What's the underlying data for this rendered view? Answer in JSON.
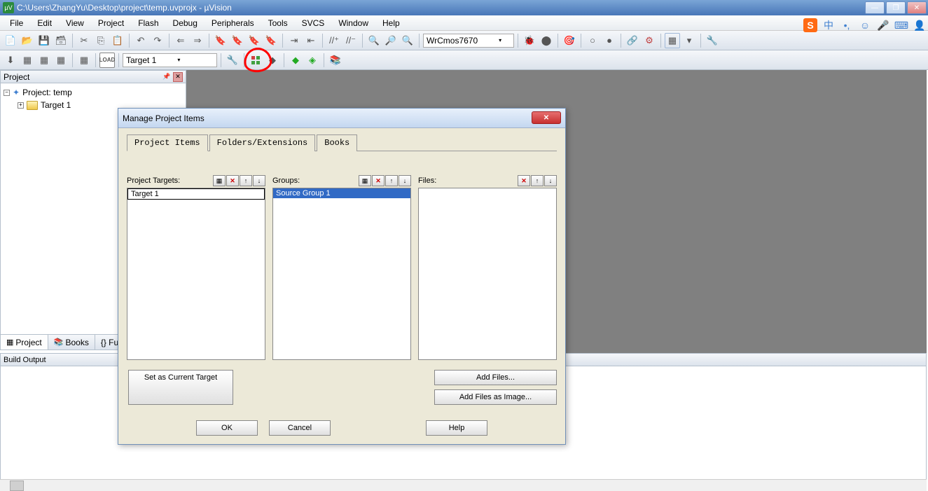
{
  "titlebar": {
    "path": "C:\\Users\\ZhangYu\\Desktop\\project\\temp.uvprojx - µVision"
  },
  "menu": {
    "file": "File",
    "edit": "Edit",
    "view": "View",
    "project": "Project",
    "flash": "Flash",
    "debug": "Debug",
    "peripherals": "Peripherals",
    "tools": "Tools",
    "svcs": "SVCS",
    "window": "Window",
    "help": "Help"
  },
  "toolbar1": {
    "search_text": "WrCmos7670"
  },
  "toolbar2": {
    "target": "Target 1"
  },
  "project_panel": {
    "title": "Project",
    "root": "Project: temp",
    "target": "Target 1",
    "tabs": {
      "project": "Project",
      "books": "Books",
      "fun": "{} Fun"
    }
  },
  "build_output": {
    "title": "Build Output"
  },
  "dialog": {
    "title": "Manage Project Items",
    "tabs": {
      "items": "Project Items",
      "folders": "Folders/Extensions",
      "books": "Books"
    },
    "col_targets": "Project Targets:",
    "col_groups": "Groups:",
    "col_files": "Files:",
    "target_item": "Target 1",
    "group_item": "Source Group 1",
    "btn_set_current": "Set as Current Target",
    "btn_add_files": "Add Files...",
    "btn_add_image": "Add Files as Image...",
    "ok": "OK",
    "cancel": "Cancel",
    "help": "Help"
  },
  "ime": {
    "s": "S",
    "zh": "中",
    "comma": "•,",
    "smile": "☺",
    "mic": "🎤",
    "kb": "⌨",
    "person": "👤"
  }
}
